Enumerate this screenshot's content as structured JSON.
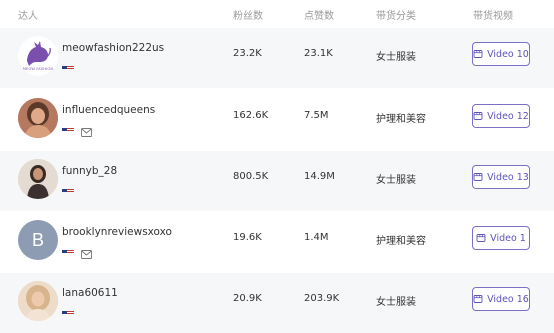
{
  "headers": {
    "influencer": "达人",
    "followers": "粉丝数",
    "likes": "点赞数",
    "category": "带货分类",
    "videos": "带货视频"
  },
  "rows": [
    {
      "name": "meowfashion222us",
      "followers": "23.2K",
      "likes": "23.1K",
      "category": "女士服装",
      "video": "Video 10",
      "avatar": "logo",
      "logo_text": "MEOW FASHION",
      "has_mail": false
    },
    {
      "name": "influencedqueens",
      "followers": "162.6K",
      "likes": "7.5M",
      "category": "护理和美容",
      "video": "Video 12",
      "avatar": "photo",
      "has_mail": true
    },
    {
      "name": "funnyb_28",
      "followers": "800.5K",
      "likes": "14.9M",
      "category": "女士服装",
      "video": "Video 13",
      "avatar": "photo",
      "has_mail": false
    },
    {
      "name": "brooklynreviewsxoxo",
      "followers": "19.6K",
      "likes": "1.4M",
      "category": "护理和美容",
      "video": "Video 1",
      "avatar": "letter",
      "initial": "B",
      "has_mail": true
    },
    {
      "name": "lana60611",
      "followers": "20.9K",
      "likes": "203.9K",
      "category": "女士服装",
      "video": "Video 16",
      "avatar": "photo",
      "has_mail": false
    }
  ],
  "colors": {
    "accent": "#5d54b8",
    "letter_avatar_bg": "#8d9bb3",
    "row_shade": "#f6f7f9"
  }
}
